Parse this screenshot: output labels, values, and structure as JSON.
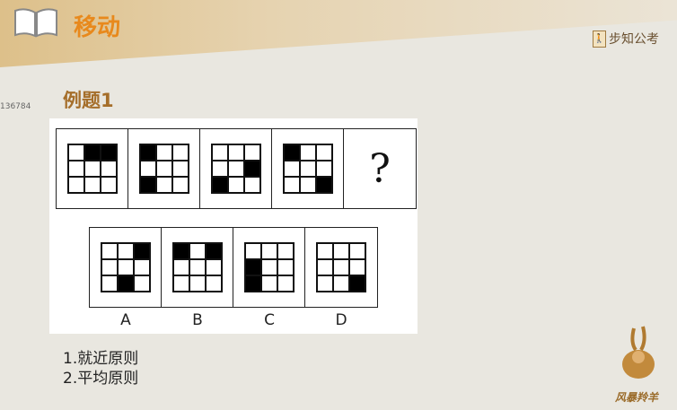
{
  "header": {
    "title": "移动",
    "brand": "步知公考"
  },
  "watermark": "136784",
  "example_title": "例题1",
  "question": {
    "panels": [
      [
        1,
        2
      ],
      [
        0,
        6
      ],
      [
        5,
        6
      ],
      [
        0,
        8
      ]
    ],
    "unknown": "?"
  },
  "options": [
    {
      "label": "A",
      "filled": [
        2,
        7
      ]
    },
    {
      "label": "B",
      "filled": [
        0,
        2
      ]
    },
    {
      "label": "C",
      "filled": [
        3,
        6
      ]
    },
    {
      "label": "D",
      "filled": [
        8
      ]
    }
  ],
  "rules": [
    "1.就近原则",
    "2.平均原则"
  ],
  "mascot": "风暴羚羊",
  "colors": {
    "title": "#e8891c",
    "example": "#a56e2a"
  }
}
